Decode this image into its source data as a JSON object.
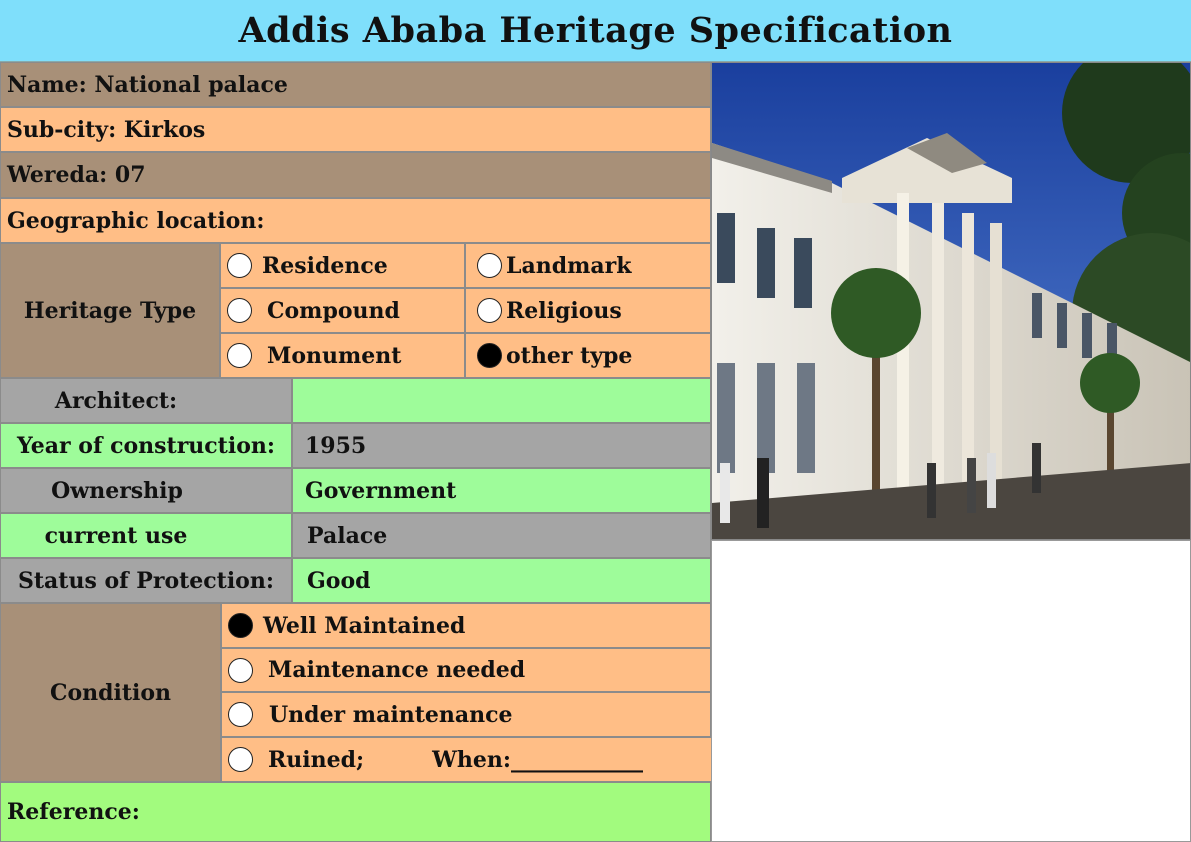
{
  "title": "Addis Ababa Heritage Specification",
  "fields": {
    "name": "Name: National palace",
    "subcity": "Sub-city: Kirkos",
    "wereda": "Wereda:  07",
    "geo": "Geographic location:"
  },
  "heritage_type": {
    "label": "Heritage Type",
    "options": [
      {
        "label": "Residence",
        "selected": false
      },
      {
        "label": "Landmark",
        "selected": false
      },
      {
        "label": "Compound",
        "selected": false
      },
      {
        "label": "Religious",
        "selected": false
      },
      {
        "label": "Monument",
        "selected": false
      },
      {
        "label": "other type",
        "selected": true
      }
    ]
  },
  "details": [
    {
      "label": "Architect:",
      "value": ""
    },
    {
      "label": "Year of construction:",
      "value": "1955"
    },
    {
      "label": "Ownership",
      "value": "Government"
    },
    {
      "label": "current use",
      "value": "Palace"
    },
    {
      "label": "Status of Protection:",
      "value": "Good"
    }
  ],
  "condition": {
    "label": "Condition",
    "options": [
      {
        "label": "Well Maintained",
        "selected": true
      },
      {
        "label": "Maintenance needed",
        "selected": false
      },
      {
        "label": "Under maintenance",
        "selected": false
      },
      {
        "label": "Ruined;",
        "selected": false
      }
    ],
    "when_label": "When:____________"
  },
  "reference": "Reference:",
  "colors": {
    "header": "#7fdffb",
    "brown": "#a89078",
    "peach": "#ffbe86",
    "green": "#9efc9a",
    "gray": "#a5a5a5"
  }
}
